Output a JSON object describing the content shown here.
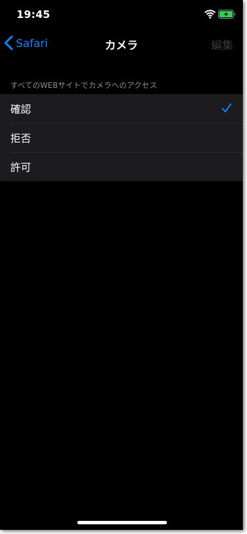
{
  "status_bar": {
    "time": "19:45",
    "icons": [
      "wifi-icon",
      "battery-charging-icon"
    ],
    "battery_color": "#30d158"
  },
  "nav": {
    "back_label": "Safari",
    "title": "カメラ",
    "edit_label": "編集"
  },
  "section": {
    "header": "すべてのWEBサイトでカメラへのアクセス",
    "options": [
      {
        "label": "確認",
        "selected": true
      },
      {
        "label": "拒否",
        "selected": false
      },
      {
        "label": "許可",
        "selected": false
      }
    ]
  },
  "colors": {
    "accent": "#0a84ff",
    "background": "#000000",
    "cell": "#1c1c1e",
    "secondary_text": "#8e8e93"
  }
}
